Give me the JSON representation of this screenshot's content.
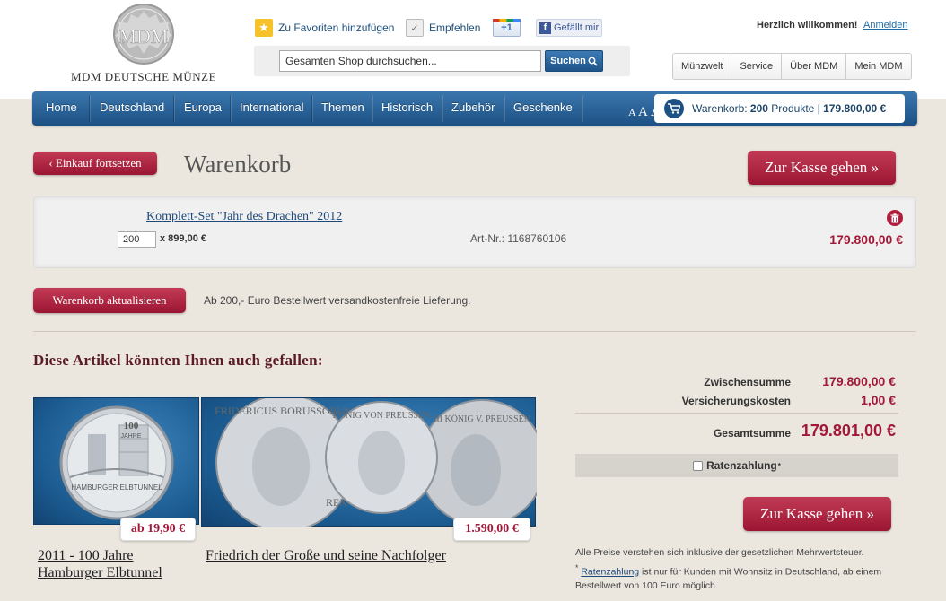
{
  "header": {
    "logo_text": "MDM DEUTSCHE MÜNZE",
    "logo_monogram": "MDM",
    "favorites": "Zu Favoriten hinzufügen",
    "recommend": "Empfehlen",
    "gplus": "+1",
    "fb_like": "Gefällt mir",
    "search_placeholder": "Gesamten Shop durchsuchen...",
    "search_button": "Suchen",
    "welcome": "Herzlich willkommen!",
    "login": "Anmelden",
    "top_links": [
      "Münzwelt",
      "Service",
      "Über MDM",
      "Mein MDM"
    ]
  },
  "nav": {
    "items": [
      "Home",
      "Deutschland",
      "Europa",
      "International",
      "Themen",
      "Historisch",
      "Zubehör",
      "Geschenke"
    ],
    "font_sizes": [
      "A",
      "A",
      "A"
    ],
    "cart_label": "Warenkorb:",
    "cart_count": "200",
    "cart_products": "Produkte |",
    "cart_total": "179.800,00 €"
  },
  "cart": {
    "continue_button": "‹ Einkauf fortsetzen",
    "title": "Warenkorb",
    "checkout_button": "Zur Kasse gehen »",
    "item": {
      "name": "Komplett-Set \"Jahr des Drachen\" 2012",
      "quantity": "200",
      "unit_price": "x 899,00 €",
      "art_nr": "Art-Nr.: 1168760106",
      "total": "179.800,00 €"
    },
    "update_button": "Warenkorb aktualisieren",
    "shipping_note": "Ab 200,- Euro Bestellwert versandkostenfreie Lieferung."
  },
  "recommendations": {
    "title": "Diese Artikel könnten Ihnen auch gefallen:",
    "products": [
      {
        "name": "2011 - 100 Jahre Hamburger Elbtunnel",
        "price": "ab 19,90 €",
        "coin_text_1": "100",
        "coin_text_2": "JAHRE",
        "coin_text_3": "HAMBURGER ELBTUNNEL"
      },
      {
        "name": "Friedrich der Große und seine Nachfolger",
        "price": "1.590,00 €",
        "coin_text_1": "FRIDERICUS BORUSSORUM",
        "coin_text_2": "KÖNIG VON PREUSSEN",
        "coin_text_3": "III KÖNIG V. PREUSSEN",
        "coin_text_4": "REX"
      }
    ]
  },
  "summary": {
    "subtotal_label": "Zwischensumme",
    "subtotal": "179.800,00 €",
    "insurance_label": "Versicherungskosten",
    "insurance": "1,00 €",
    "total_label": "Gesamtsumme",
    "total": "179.801,00 €",
    "installment": "Ratenzahlung",
    "installment_mark": "*",
    "checkout_button": "Zur Kasse gehen »",
    "legal_1": "Alle Preise verstehen sich inklusive der gesetzlichen Mehrwertsteuer.",
    "legal_2_mark": "*",
    "legal_2_link": "Ratenzahlung",
    "legal_2_text": " ist nur für Kunden mit Wohnsitz in Deutschland, ab einem Bestellwert von 100 Euro möglich."
  },
  "colors": {
    "accent_red": "#a21838",
    "nav_blue": "#1d5184",
    "background": "#ebe7df"
  }
}
